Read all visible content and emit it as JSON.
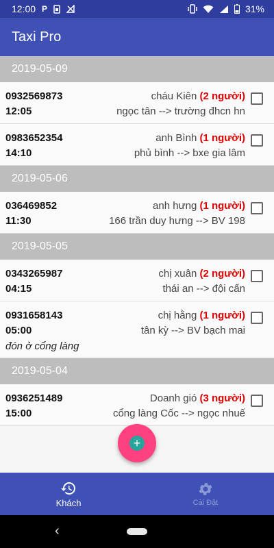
{
  "status_bar": {
    "time": "12:00",
    "left_icons": [
      "p-icon",
      "sim-icon",
      "signal-slash-icon"
    ],
    "battery": "31%"
  },
  "app_bar": {
    "title": "Taxi Pro"
  },
  "groups": [
    {
      "date": "2019-05-09",
      "rides": [
        {
          "phone": "0932569873",
          "time": "12:05",
          "name": "cháu Kiên",
          "count": "(2 người)",
          "route": "ngọc tân --> trường đhcn hn",
          "note": ""
        },
        {
          "phone": "0983652354",
          "time": "14:10",
          "name": "anh Bình",
          "count": "(1 người)",
          "route": "phủ bình --> bxe gia lâm",
          "note": ""
        }
      ]
    },
    {
      "date": "2019-05-06",
      "rides": [
        {
          "phone": "036469852",
          "time": "11:30",
          "name": "anh hưng",
          "count": "(1 người)",
          "route": "166 trần duy hưng --> BV 198",
          "note": ""
        }
      ]
    },
    {
      "date": "2019-05-05",
      "rides": [
        {
          "phone": "0343265987",
          "time": "04:15",
          "name": "chị xuân",
          "count": "(2 người)",
          "route": "thái an --> đội cấn",
          "note": ""
        },
        {
          "phone": "0931658143",
          "time": "05:00",
          "name": "chị hằng",
          "count": "(1 người)",
          "route": "tân kỳ --> BV bạch mai",
          "note": "đón ở cổng làng"
        }
      ]
    },
    {
      "date": "2019-05-04",
      "rides": [
        {
          "phone": "0936251489",
          "time": "15:00",
          "name": "Doanh gió",
          "count": "(3 người)",
          "route": "cổng làng Cốc --> ngọc nhuế",
          "note": ""
        }
      ]
    }
  ],
  "fab": {
    "icon": "plus-icon"
  },
  "bottom_nav": [
    {
      "label": "Khách",
      "icon": "history-icon",
      "active": true
    },
    {
      "label": "Cài Đặt",
      "icon": "gear-icon",
      "active": false
    }
  ],
  "colors": {
    "primary": "#3f51b5",
    "primary_dark": "#2f3d9f",
    "accent": "#ff4081",
    "count_red": "#e00000",
    "date_header": "#bdbdbd"
  }
}
